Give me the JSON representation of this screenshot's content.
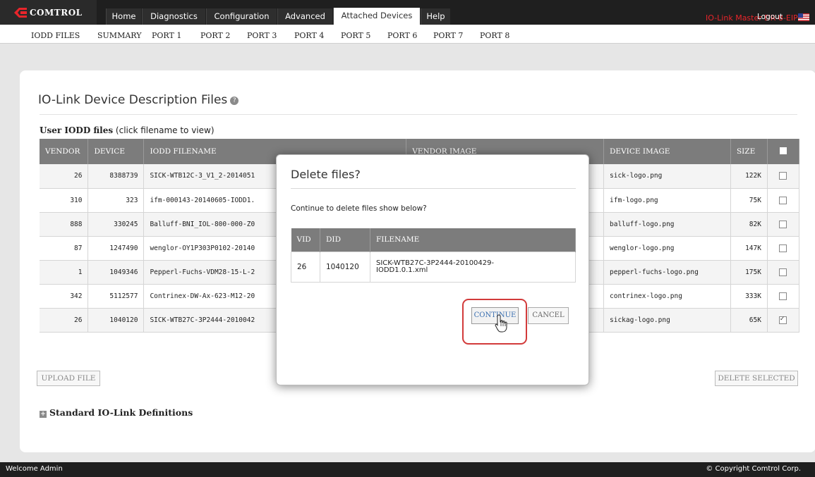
{
  "brand": {
    "name": "COMTROL"
  },
  "nav": {
    "tabs": [
      {
        "label": "Home"
      },
      {
        "label": "Diagnostics"
      },
      {
        "label": "Configuration"
      },
      {
        "label": "Advanced"
      },
      {
        "label": "Attached Devices"
      },
      {
        "label": "Help"
      }
    ],
    "active_tab": "Attached Devices",
    "device_name": "IO-Link Master DR-8-EIP",
    "logout": "Logout",
    "flag_icon": "us-flag-icon"
  },
  "subnav": {
    "items": [
      "IODD FILES",
      "SUMMARY",
      "PORT 1",
      "PORT 2",
      "PORT 3",
      "PORT 4",
      "PORT 5",
      "PORT 6",
      "PORT 7",
      "PORT 8"
    ]
  },
  "page": {
    "title": "IO-Link Device Description Files",
    "help_icon": "help-icon",
    "section_label_bold": "User IODD files",
    "section_label_note": " (click filename to view)",
    "standard_defs": "Standard IO-Link Definitions",
    "upload_button": "UPLOAD FILE",
    "delete_button": "DELETE SELECTED"
  },
  "files_table": {
    "columns": [
      "VENDOR",
      "DEVICE",
      "IODD FILENAME",
      "VENDOR IMAGE",
      "DEVICE IMAGE",
      "SIZE"
    ],
    "rows": [
      {
        "vendor": "26",
        "device": "8388739",
        "filename": "SICK-WTB12C-3_V1_2-2014051",
        "device_image": "sick-logo.png",
        "size": "122K",
        "checked": false
      },
      {
        "vendor": "310",
        "device": "323",
        "filename": "ifm-000143-20140605-IODD1.",
        "device_image": "ifm-logo.png",
        "size": "75K",
        "checked": false
      },
      {
        "vendor": "888",
        "device": "330245",
        "filename": "Balluff-BNI_IOL-800-000-Z0",
        "device_image": "balluff-logo.png",
        "size": "82K",
        "checked": false
      },
      {
        "vendor": "87",
        "device": "1247490",
        "filename": "wenglor-OY1P303P0102-20140",
        "device_image": "wenglor-logo.png",
        "size": "147K",
        "checked": false
      },
      {
        "vendor": "1",
        "device": "1049346",
        "filename": "Pepperl-Fuchs-VDM28-15-L-2",
        "device_image": "pepperl-fuchs-logo.png",
        "size": "175K",
        "checked": false
      },
      {
        "vendor": "342",
        "device": "5112577",
        "filename": "Contrinex-DW-Ax-623-M12-20",
        "device_image": "contrinex-logo.png",
        "size": "333K",
        "checked": false
      },
      {
        "vendor": "26",
        "device": "1040120",
        "filename": "SICK-WTB27C-3P2444-2010042",
        "device_image": "sickag-logo.png",
        "size": "65K",
        "checked": true
      }
    ]
  },
  "dialog": {
    "title": "Delete files?",
    "message": "Continue to delete files show below?",
    "columns": [
      "VID",
      "DID",
      "FILENAME"
    ],
    "rows": [
      {
        "vid": "26",
        "did": "1040120",
        "filename_line1": "SICK-WTB27C-3P2444-20100429-",
        "filename_line2": "IODD1.0.1.xml"
      }
    ],
    "continue_label": "CONTINUE",
    "cancel_label": "CANCEL"
  },
  "footer": {
    "welcome": "Welcome Admin",
    "copyright": "© Copyright Comtrol Corp."
  },
  "colors": {
    "topbar": "#1f1f1f",
    "device_name": "#e8252b",
    "table_header": "#7c7c7c",
    "highlight_ring": "#d23a3a",
    "continue_text": "#3a6fb0"
  }
}
